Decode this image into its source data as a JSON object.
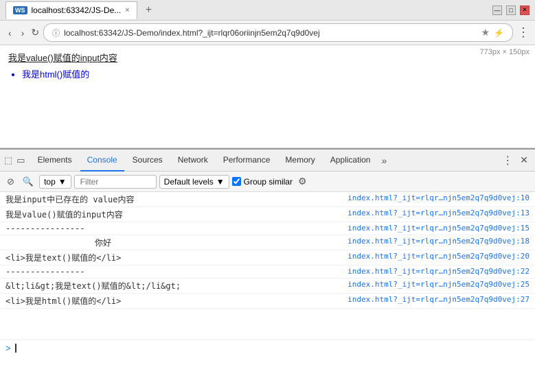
{
  "titleBar": {
    "tab": {
      "icon": "WS",
      "label": "localhost:63342/JS-De...",
      "closeLabel": "×"
    },
    "newTabLabel": "+",
    "controls": [
      "—",
      "□",
      "✕"
    ]
  },
  "addressBar": {
    "back": "‹",
    "forward": "›",
    "reload": "↻",
    "url": "localhost:63342/JS-Demo/index.html?_ijt=rlqr06oriinjn5em2q7q9d0vej",
    "lockIcon": "ⓘ",
    "star": "★",
    "power": "⚡",
    "menu": "⋮"
  },
  "pageContent": {
    "sizeLabel": "773px × 150px",
    "line1": "我是value()赋值的input内容",
    "listItem": "我是html()赋值的"
  },
  "devtools": {
    "tabs": [
      {
        "label": "Elements",
        "active": false
      },
      {
        "label": "Console",
        "active": true
      },
      {
        "label": "Sources",
        "active": false
      },
      {
        "label": "Network",
        "active": false
      },
      {
        "label": "Performance",
        "active": false
      },
      {
        "label": "Memory",
        "active": false
      },
      {
        "label": "Application",
        "active": false
      }
    ],
    "moreLabel": "»",
    "menuIcon": "⋮",
    "closeIcon": "✕"
  },
  "consoleToolbar": {
    "clearIcon": "🚫",
    "searchIcon": "⊘",
    "contextLabel": "top",
    "contextArrow": "▼",
    "filterPlaceholder": "Filter",
    "defaultLevels": "Default levels",
    "levelsArrow": "▼",
    "groupSimilar": "Group similar",
    "settingsIcon": "⚙"
  },
  "consoleRows": [
    {
      "msg": "我是input中已存在的 value内容",
      "link": "index.html?_ijt=rlqr…njn5em2q7q9d0vej:10"
    },
    {
      "msg": "我是value()赋值的input内容",
      "link": "index.html?_ijt=rlqr…njn5em2q7q9d0vej:13"
    },
    {
      "msg": "----------------",
      "link": "index.html?_ijt=rlqr…njn5em2q7q9d0vej:15"
    },
    {
      "msg": "                  你好",
      "link": "index.html?_ijt=rlqr…njn5em2q7q9d0vej:18"
    },
    {
      "msg": "<li>我是text()赋值的</li>",
      "link": "index.html?_ijt=rlqr…njn5em2q7q9d0vej:20"
    },
    {
      "msg": "----------------",
      "link": "index.html?_ijt=rlqr…njn5em2q7q9d0vej:22"
    },
    {
      "msg": "&lt;li&gt;我是text()赋值的&lt;/li&gt;",
      "link": "index.html?_ijt=rlqr…njn5em2q7q9d0vej:25"
    },
    {
      "msg": "<li>我是html()赋值的</li>",
      "link": "index.html?_ijt=rlqr…njn5em2q7q9d0vej:27"
    }
  ],
  "consolePrompt": ">"
}
